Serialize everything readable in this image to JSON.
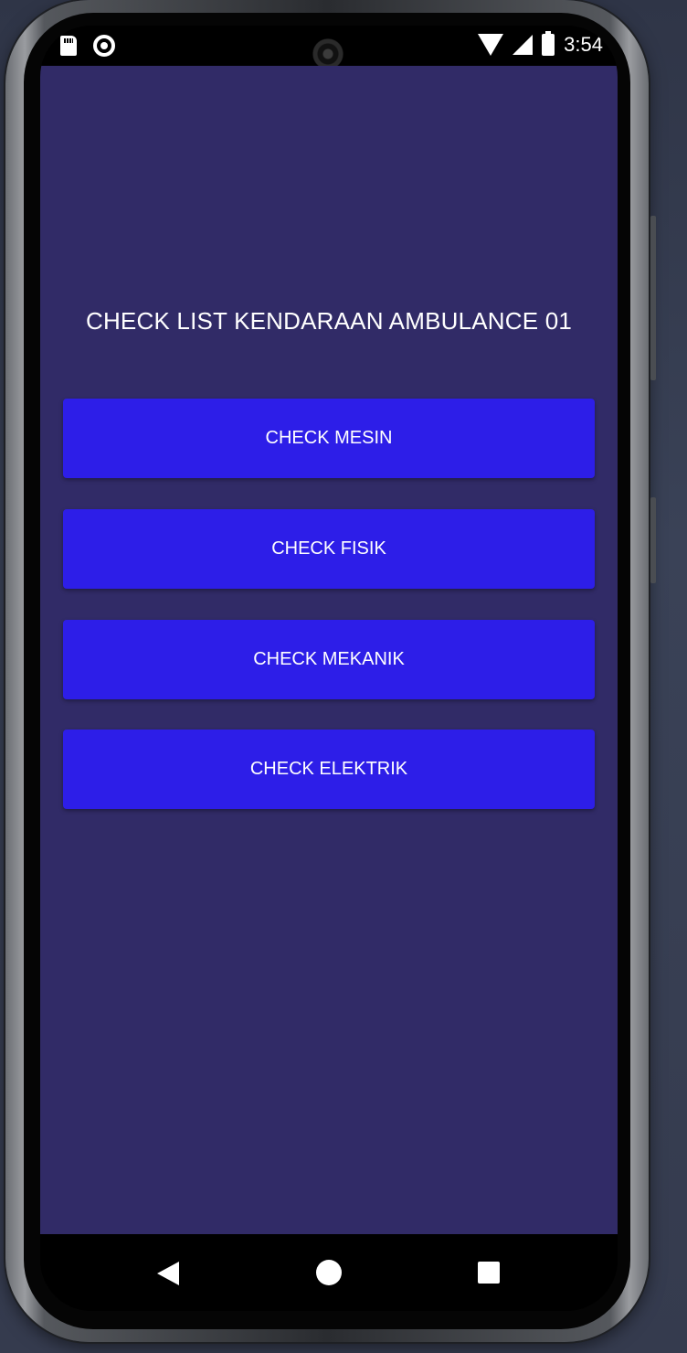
{
  "status_bar": {
    "time": "3:54",
    "icons": [
      "sd-card-icon",
      "record-icon",
      "wifi-icon",
      "cellular-icon",
      "battery-icon"
    ]
  },
  "app": {
    "title": "CHECK LIST KENDARAAN AMBULANCE 01",
    "buttons": [
      {
        "label": "CHECK MESIN"
      },
      {
        "label": "CHECK FISIK"
      },
      {
        "label": "CHECK MEKANIK"
      },
      {
        "label": "CHECK ELEKTRIK"
      }
    ]
  },
  "nav_bar": {
    "icons": [
      "back-icon",
      "home-icon",
      "recents-icon"
    ]
  },
  "colors": {
    "app_background": "#312b67",
    "button": "#2d1ee8",
    "text": "#ffffff"
  }
}
